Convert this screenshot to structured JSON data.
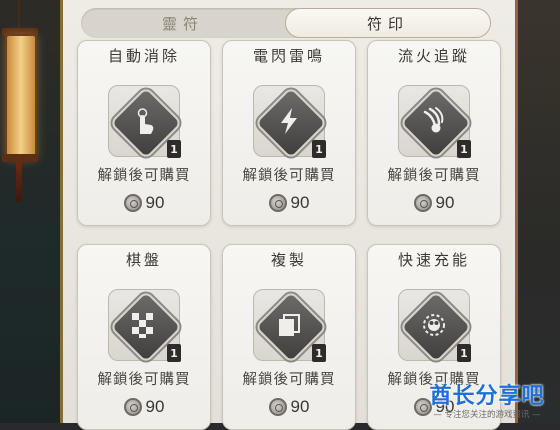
{
  "tabs": [
    {
      "label": "靈符",
      "active": false
    },
    {
      "label": "符印",
      "active": true
    }
  ],
  "cards": [
    {
      "name": "自動消除",
      "icon": "hand-tap-icon",
      "level": "1",
      "status": "解鎖後可購買",
      "price": "90"
    },
    {
      "name": "電閃雷鳴",
      "icon": "lightning-icon",
      "level": "1",
      "status": "解鎖後可購買",
      "price": "90"
    },
    {
      "name": "流火追蹤",
      "icon": "fire-comet-icon",
      "level": "1",
      "status": "解鎖後可購買",
      "price": "90"
    },
    {
      "name": "棋盤",
      "icon": "checkerboard-icon",
      "level": "1",
      "status": "解鎖後可購買",
      "price": "90"
    },
    {
      "name": "複製",
      "icon": "copy-icon",
      "level": "1",
      "status": "解鎖後可購買",
      "price": "90"
    },
    {
      "name": "快速充能",
      "icon": "charge-orb-icon",
      "level": "1",
      "status": "解鎖後可購買",
      "price": "90"
    }
  ],
  "watermark": {
    "title": "酋长分享吧",
    "subtitle": "— 专注您关注的游戏资讯 —"
  }
}
